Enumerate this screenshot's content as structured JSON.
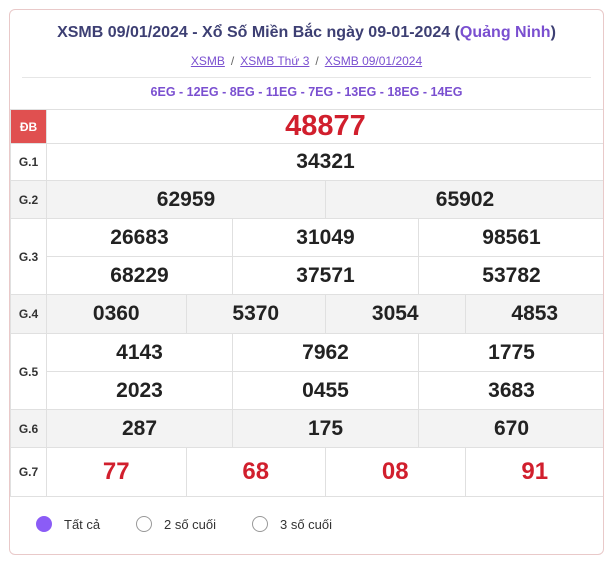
{
  "header": {
    "title_main": "XSMB 09/01/2024 - Xổ Số Miền Bắc ngày 09-01-2024 (",
    "title_province": "Quảng Ninh",
    "title_close": ")",
    "breadcrumbs": [
      "XSMB",
      "XSMB Thứ 3",
      "XSMB 09/01/2024"
    ],
    "breadcrumb_sep": "/",
    "codes": "6EG - 12EG - 8EG - 11EG - 7EG - 13EG - 18EG - 14EG"
  },
  "prizes": {
    "db": {
      "label": "ĐB",
      "values": [
        "48877"
      ]
    },
    "g1": {
      "label": "G.1",
      "values": [
        "34321"
      ]
    },
    "g2": {
      "label": "G.2",
      "values": [
        "62959",
        "65902"
      ]
    },
    "g3": {
      "label": "G.3",
      "values": [
        "26683",
        "31049",
        "98561",
        "68229",
        "37571",
        "53782"
      ]
    },
    "g4": {
      "label": "G.4",
      "values": [
        "0360",
        "5370",
        "3054",
        "4853"
      ]
    },
    "g5": {
      "label": "G.5",
      "values": [
        "4143",
        "7962",
        "1775",
        "2023",
        "0455",
        "3683"
      ]
    },
    "g6": {
      "label": "G.6",
      "values": [
        "287",
        "175",
        "670"
      ]
    },
    "g7": {
      "label": "G.7",
      "values": [
        "77",
        "68",
        "08",
        "91"
      ]
    }
  },
  "filters": {
    "options": [
      "Tất cả",
      "2 số cuối",
      "3 số cuối"
    ],
    "selected": "Tất cả"
  },
  "colors": {
    "accent": "#8b5cf6",
    "red": "#d11f2d",
    "db_bg": "#e05050"
  }
}
